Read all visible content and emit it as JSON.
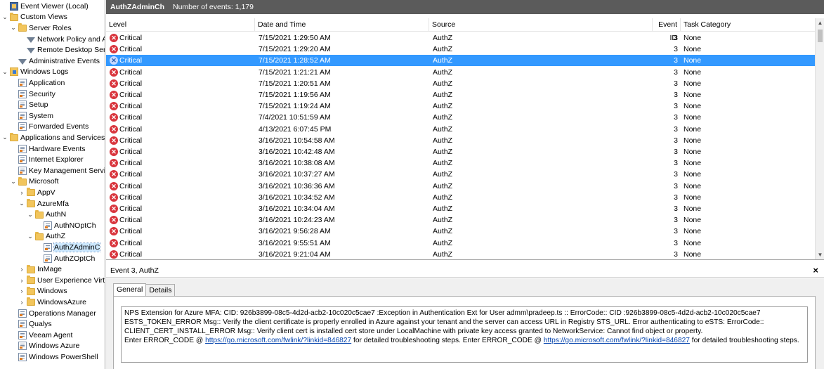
{
  "tree": {
    "items": [
      {
        "label": "Event Viewer (Local)",
        "indent": 0,
        "chev": "",
        "icon": "root",
        "selected": false
      },
      {
        "label": "Custom Views",
        "indent": 0,
        "chev": "open",
        "icon": "folder",
        "selected": false
      },
      {
        "label": "Server Roles",
        "indent": 1,
        "chev": "open",
        "icon": "folder",
        "selected": false
      },
      {
        "label": "Network Policy and A",
        "indent": 2,
        "chev": "",
        "icon": "filter",
        "selected": false
      },
      {
        "label": "Remote Desktop Serv",
        "indent": 2,
        "chev": "",
        "icon": "filter",
        "selected": false
      },
      {
        "label": "Administrative Events",
        "indent": 1,
        "chev": "",
        "icon": "filter",
        "selected": false
      },
      {
        "label": "Windows Logs",
        "indent": 0,
        "chev": "open",
        "icon": "winlogs",
        "selected": false
      },
      {
        "label": "Application",
        "indent": 1,
        "chev": "",
        "icon": "log",
        "selected": false
      },
      {
        "label": "Security",
        "indent": 1,
        "chev": "",
        "icon": "log",
        "selected": false
      },
      {
        "label": "Setup",
        "indent": 1,
        "chev": "",
        "icon": "log",
        "selected": false
      },
      {
        "label": "System",
        "indent": 1,
        "chev": "",
        "icon": "log",
        "selected": false
      },
      {
        "label": "Forwarded Events",
        "indent": 1,
        "chev": "",
        "icon": "log",
        "selected": false
      },
      {
        "label": "Applications and Services Lo",
        "indent": 0,
        "chev": "open",
        "icon": "folder",
        "selected": false
      },
      {
        "label": "Hardware Events",
        "indent": 1,
        "chev": "",
        "icon": "log",
        "selected": false
      },
      {
        "label": "Internet Explorer",
        "indent": 1,
        "chev": "",
        "icon": "log",
        "selected": false
      },
      {
        "label": "Key Management Service",
        "indent": 1,
        "chev": "",
        "icon": "log",
        "selected": false
      },
      {
        "label": "Microsoft",
        "indent": 1,
        "chev": "open",
        "icon": "folder",
        "selected": false
      },
      {
        "label": "AppV",
        "indent": 2,
        "chev": "closed",
        "icon": "folder",
        "selected": false
      },
      {
        "label": "AzureMfa",
        "indent": 2,
        "chev": "open",
        "icon": "folder",
        "selected": false
      },
      {
        "label": "AuthN",
        "indent": 3,
        "chev": "open",
        "icon": "folder",
        "selected": false
      },
      {
        "label": "AuthNOptCh",
        "indent": 4,
        "chev": "",
        "icon": "log",
        "selected": false
      },
      {
        "label": "AuthZ",
        "indent": 3,
        "chev": "open",
        "icon": "folder",
        "selected": false
      },
      {
        "label": "AuthZAdminC",
        "indent": 4,
        "chev": "",
        "icon": "log",
        "selected": true
      },
      {
        "label": "AuthZOptCh",
        "indent": 4,
        "chev": "",
        "icon": "log",
        "selected": false
      },
      {
        "label": "InMage",
        "indent": 2,
        "chev": "closed",
        "icon": "folder",
        "selected": false
      },
      {
        "label": "User Experience Virtu",
        "indent": 2,
        "chev": "closed",
        "icon": "folder",
        "selected": false
      },
      {
        "label": "Windows",
        "indent": 2,
        "chev": "closed",
        "icon": "folder",
        "selected": false
      },
      {
        "label": "WindowsAzure",
        "indent": 2,
        "chev": "closed",
        "icon": "folder",
        "selected": false
      },
      {
        "label": "Operations Manager",
        "indent": 1,
        "chev": "",
        "icon": "log",
        "selected": false
      },
      {
        "label": "Qualys",
        "indent": 1,
        "chev": "",
        "icon": "log",
        "selected": false
      },
      {
        "label": "Veeam Agent",
        "indent": 1,
        "chev": "",
        "icon": "log",
        "selected": false
      },
      {
        "label": "Windows Azure",
        "indent": 1,
        "chev": "",
        "icon": "log",
        "selected": false
      },
      {
        "label": "Windows PowerShell",
        "indent": 1,
        "chev": "",
        "icon": "log",
        "selected": false
      }
    ]
  },
  "list": {
    "log_name": "AuthZAdminCh",
    "count_text": "Number of events: 1,179",
    "columns": {
      "level": "Level",
      "date": "Date and Time",
      "source": "Source",
      "event_id": "Event ID",
      "category": "Task Category"
    },
    "rows": [
      {
        "level": "Critical",
        "date": "7/15/2021 1:29:50 AM",
        "source": "AuthZ",
        "id": "3",
        "cat": "None",
        "selected": false
      },
      {
        "level": "Critical",
        "date": "7/15/2021 1:29:20 AM",
        "source": "AuthZ",
        "id": "3",
        "cat": "None",
        "selected": false
      },
      {
        "level": "Critical",
        "date": "7/15/2021 1:28:52 AM",
        "source": "AuthZ",
        "id": "3",
        "cat": "None",
        "selected": true
      },
      {
        "level": "Critical",
        "date": "7/15/2021 1:21:21 AM",
        "source": "AuthZ",
        "id": "3",
        "cat": "None",
        "selected": false
      },
      {
        "level": "Critical",
        "date": "7/15/2021 1:20:51 AM",
        "source": "AuthZ",
        "id": "3",
        "cat": "None",
        "selected": false
      },
      {
        "level": "Critical",
        "date": "7/15/2021 1:19:56 AM",
        "source": "AuthZ",
        "id": "3",
        "cat": "None",
        "selected": false
      },
      {
        "level": "Critical",
        "date": "7/15/2021 1:19:24 AM",
        "source": "AuthZ",
        "id": "3",
        "cat": "None",
        "selected": false
      },
      {
        "level": "Critical",
        "date": "7/4/2021 10:51:59 AM",
        "source": "AuthZ",
        "id": "3",
        "cat": "None",
        "selected": false
      },
      {
        "level": "Critical",
        "date": "4/13/2021 6:07:45 PM",
        "source": "AuthZ",
        "id": "3",
        "cat": "None",
        "selected": false
      },
      {
        "level": "Critical",
        "date": "3/16/2021 10:54:58 AM",
        "source": "AuthZ",
        "id": "3",
        "cat": "None",
        "selected": false
      },
      {
        "level": "Critical",
        "date": "3/16/2021 10:42:48 AM",
        "source": "AuthZ",
        "id": "3",
        "cat": "None",
        "selected": false
      },
      {
        "level": "Critical",
        "date": "3/16/2021 10:38:08 AM",
        "source": "AuthZ",
        "id": "3",
        "cat": "None",
        "selected": false
      },
      {
        "level": "Critical",
        "date": "3/16/2021 10:37:27 AM",
        "source": "AuthZ",
        "id": "3",
        "cat": "None",
        "selected": false
      },
      {
        "level": "Critical",
        "date": "3/16/2021 10:36:36 AM",
        "source": "AuthZ",
        "id": "3",
        "cat": "None",
        "selected": false
      },
      {
        "level": "Critical",
        "date": "3/16/2021 10:34:52 AM",
        "source": "AuthZ",
        "id": "3",
        "cat": "None",
        "selected": false
      },
      {
        "level": "Critical",
        "date": "3/16/2021 10:34:04 AM",
        "source": "AuthZ",
        "id": "3",
        "cat": "None",
        "selected": false
      },
      {
        "level": "Critical",
        "date": "3/16/2021 10:24:23 AM",
        "source": "AuthZ",
        "id": "3",
        "cat": "None",
        "selected": false
      },
      {
        "level": "Critical",
        "date": "3/16/2021 9:56:28 AM",
        "source": "AuthZ",
        "id": "3",
        "cat": "None",
        "selected": false
      },
      {
        "level": "Critical",
        "date": "3/16/2021 9:55:51 AM",
        "source": "AuthZ",
        "id": "3",
        "cat": "None",
        "selected": false
      },
      {
        "level": "Critical",
        "date": "3/16/2021 9:21:04 AM",
        "source": "AuthZ",
        "id": "3",
        "cat": "None",
        "selected": false
      }
    ]
  },
  "detail": {
    "title": "Event 3, AuthZ",
    "close_label": "×",
    "tabs": {
      "general": "General",
      "details": "Details"
    },
    "description": {
      "line1": "NPS Extension for Azure MFA:  CID: 926b3899-08c5-4d2d-acb2-10c020c5cae7 :Exception in Authentication Ext for User admm\\pradeep.ts :: ErrorCode:: CID :926b3899-08c5-4d2d-acb2-10c020c5cae7 ESTS_TOKEN_ERROR Msg:: Verify the client certificate is properly enrolled in Azure against your tenant and the server can access URL in Registry STS_URL. Error authenticating to eSTS: ErrorCode:: CLIENT_CERT_INSTALL_ERROR Msg:: Verify client cert is installed cert store under LocalMachine with private key access granted to NetworkService: Cannot find object or property.",
      "part_a": " Enter ERROR_CODE @ ",
      "link1": "https://go.microsoft.com/fwlink/?linkid=846827",
      "part_b": " for detailed troubleshooting steps. Enter ERROR_CODE @ ",
      "link2": "https://go.microsoft.com/fwlink/?linkid=846827",
      "part_c": " for detailed troubleshooting steps."
    }
  },
  "colors": {
    "title_bar": "#5b5b5b",
    "selection": "#3399ff",
    "critical": "#d9363e",
    "link": "#0645ad"
  }
}
